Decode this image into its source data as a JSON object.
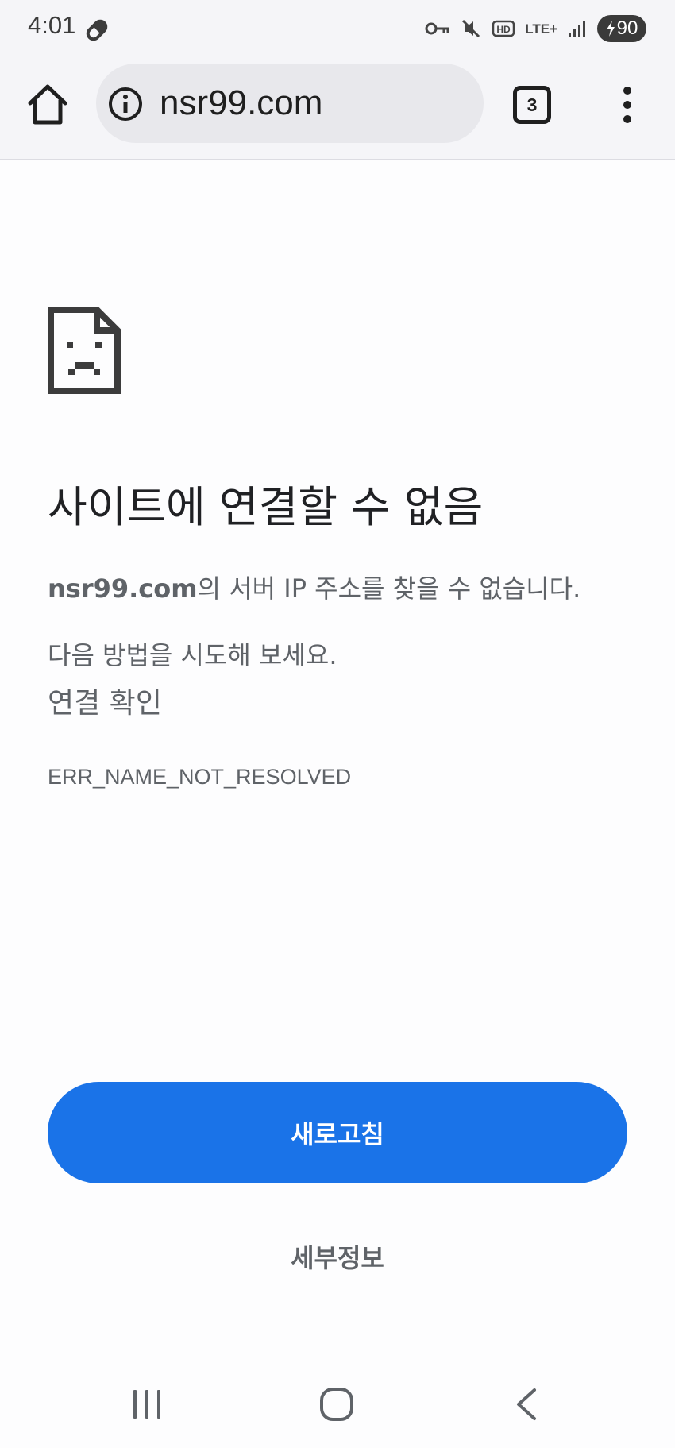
{
  "status_bar": {
    "time": "4:01",
    "network": "LTE+",
    "battery": "90"
  },
  "browser": {
    "url": "nsr99.com",
    "tab_count": "3"
  },
  "error_page": {
    "title": "사이트에 연결할 수 없음",
    "host": "nsr99.com",
    "description": "의 서버 IP 주소를 찾을 수 없습니다.",
    "suggestions_heading": "다음 방법을 시도해 보세요.",
    "suggestion_1": "연결 확인",
    "error_code": "ERR_NAME_NOT_RESOLVED",
    "reload_label": "새로고침",
    "details_label": "세부정보"
  },
  "icons": {
    "status": [
      "link-icon",
      "key-icon",
      "mute-icon",
      "hd-icon",
      "signal-icon",
      "battery-icon"
    ],
    "toolbar": [
      "home-icon",
      "info-icon",
      "tab-switcher-icon",
      "menu-icon"
    ],
    "navigation": [
      "recents-icon",
      "home-circle-icon",
      "back-icon"
    ]
  },
  "colors": {
    "accent": "#1a73e8",
    "toolbar_bg": "#f5f5f8",
    "omnibox_bg": "#e8e8ec",
    "text_primary": "#202124",
    "text_secondary": "#5f6368"
  }
}
